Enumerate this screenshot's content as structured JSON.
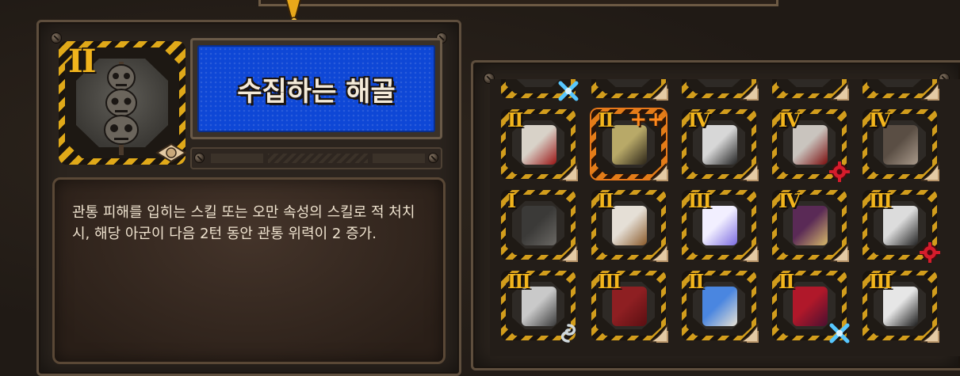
{
  "item": {
    "tier": "II",
    "name": "수집하는 해골",
    "description": "관통 피해를 입히는 스킬 또는 오만 속성의 스킬로 적 처치 시, 해당 아군이 다음 2턴 동안 관통 위력이 2 증가."
  },
  "colors": {
    "tier_gold": "#f2b51d",
    "title_blue": "#0e47d6",
    "plus_orange": "#ff8a1c",
    "frame_hazard": "#d29d1c"
  },
  "grid": {
    "top_row_partial": [
      {
        "badge": "blue-cross-icon"
      },
      {
        "badge": "cream-corner-icon"
      },
      {
        "badge": "cream-corner-icon"
      },
      {
        "badge": "cream-corner-icon"
      },
      {
        "badge": "cream-corner-icon"
      }
    ],
    "rows": [
      [
        {
          "tier": "II",
          "art": "bloody-bone-icon",
          "badge": "cream-corner-icon",
          "selected": false
        },
        {
          "tier": "II",
          "plus": "++",
          "art": "chain-belt-icon",
          "badge": "cream-corner-icon",
          "selected": true
        },
        {
          "tier": "IV",
          "art": "shattered-mask-icon",
          "badge": "cream-corner-icon",
          "selected": false
        },
        {
          "tier": "IV",
          "art": "bloody-cloth-icon",
          "badge": "red-gear-icon",
          "selected": false
        },
        {
          "tier": "IV",
          "art": "tarot-card-icon",
          "badge": "cream-corner-icon",
          "selected": false
        }
      ],
      [
        {
          "tier": "I",
          "art": "iron-box-icon",
          "badge": "cream-corner-icon",
          "selected": false
        },
        {
          "tier": "II",
          "art": "paper-stack-icon",
          "badge": "cream-corner-icon",
          "selected": false
        },
        {
          "tier": "III",
          "art": "glowing-orb-icon",
          "badge": "cream-corner-icon",
          "selected": false
        },
        {
          "tier": "IV",
          "art": "purple-tome-icon",
          "badge": "cream-corner-icon",
          "selected": false
        },
        {
          "tier": "III",
          "art": "curved-blade-icon",
          "badge": "red-gear-icon",
          "selected": false
        }
      ],
      [
        {
          "tier": "III",
          "art": "combat-knife-icon",
          "badge": "silver-swirl-icon",
          "selected": false
        },
        {
          "tier": "III",
          "art": "red-scarf-icon",
          "badge": "cream-corner-icon",
          "selected": false
        },
        {
          "tier": "II",
          "art": "can-drink-icon",
          "badge": "cream-corner-icon",
          "selected": false
        },
        {
          "tier": "II",
          "art": "anatomical-heart-icon",
          "badge": "blue-cross-icon",
          "selected": false
        },
        {
          "tier": "III",
          "art": "katana-icon",
          "badge": "cream-corner-icon",
          "selected": false
        }
      ]
    ]
  }
}
